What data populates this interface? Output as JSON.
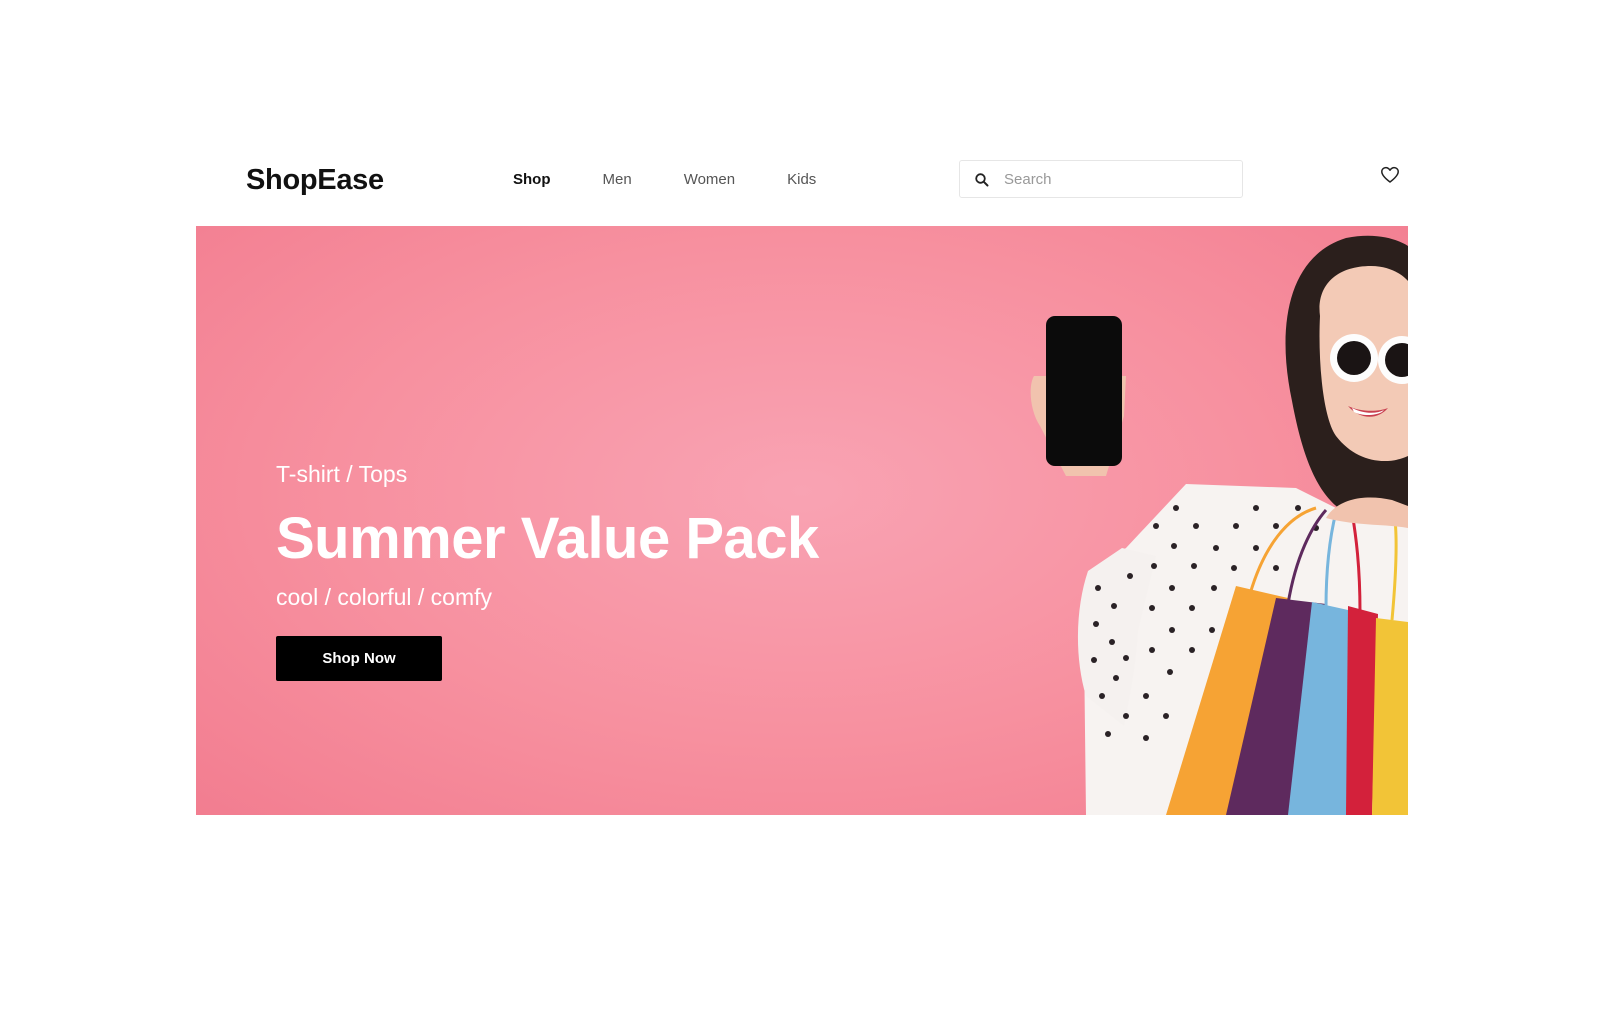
{
  "header": {
    "logo": "ShopEase",
    "nav": [
      {
        "label": "Shop",
        "active": true
      },
      {
        "label": "Men",
        "active": false
      },
      {
        "label": "Women",
        "active": false
      },
      {
        "label": "Kids",
        "active": false
      }
    ],
    "search": {
      "placeholder": "Search",
      "icon": "search-icon"
    },
    "wishlist_icon": "heart-icon"
  },
  "hero": {
    "category": "T-shirt / Tops",
    "title": "Summer Value Pack",
    "tagline": "cool / colorful / comfy",
    "cta_label": "Shop Now",
    "background_color": "#f7909f",
    "image": "woman-with-phone-and-shopping-bags"
  },
  "colors": {
    "accent": "#000000",
    "hero_pink": "#f7909f",
    "text_on_hero": "#ffffff"
  }
}
